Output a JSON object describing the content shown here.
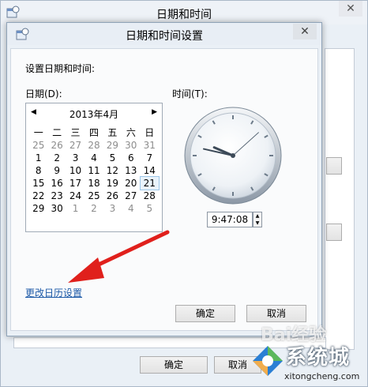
{
  "outer_window": {
    "title": "日期和时间",
    "close": "✕",
    "ok": "确定",
    "cancel": "取消"
  },
  "dialog": {
    "title": "日期和时间设置",
    "close": "✕",
    "heading": "设置日期和时间:",
    "date_label": "日期(D):",
    "time_label": "时间(T):",
    "calendar": {
      "month_label": "2013年4月",
      "prev": "◀",
      "next": "▶",
      "weekdays": [
        "一",
        "二",
        "三",
        "四",
        "五",
        "六",
        "日"
      ],
      "weeks": [
        [
          "25",
          "26",
          "27",
          "28",
          "29",
          "30",
          "31"
        ],
        [
          "1",
          "2",
          "3",
          "4",
          "5",
          "6",
          "7"
        ],
        [
          "8",
          "9",
          "10",
          "11",
          "12",
          "13",
          "14"
        ],
        [
          "15",
          "16",
          "17",
          "18",
          "19",
          "20",
          "21"
        ],
        [
          "22",
          "23",
          "24",
          "25",
          "26",
          "27",
          "28"
        ],
        [
          "29",
          "30",
          "1",
          "2",
          "3",
          "4",
          "5"
        ]
      ],
      "selected_day": "21"
    },
    "time_value": "9:47:08",
    "change_calendar_link": "更改日历设置",
    "ok": "确定",
    "cancel": "取消"
  },
  "watermark": {
    "brand": "系统城",
    "url": "xitongcheng.com",
    "baidu": "Bai经验"
  },
  "colors": {
    "arrow": "#e0201c",
    "link": "#1d5aa8"
  },
  "icons": {
    "app_icon": "calendar-clock-icon",
    "arrow": "red-arrow-annotation"
  }
}
